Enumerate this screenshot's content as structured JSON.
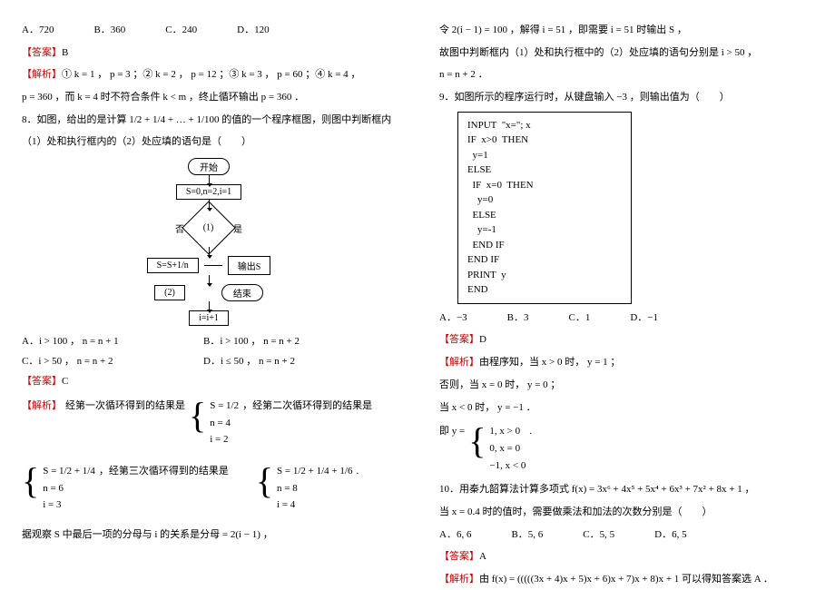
{
  "left": {
    "q7_options": [
      "A．720",
      "B．360",
      "C．240",
      "D．120"
    ],
    "q7_ans_tag": "【答案】",
    "q7_ans": "B",
    "q7_exp_tag": "【解析】",
    "q7_exp_line1": "① k = 1 ， p = 3 ；② k = 2 ， p = 12 ；③ k = 3 ， p = 60 ；④ k = 4 ，",
    "q7_exp_line2": "p = 360 ，而 k = 4 时不符合条件 k < m ，终止循环输出 p = 360 ．",
    "q8_stem_a": "8．如图，给出的是计算 1/2 + 1/4 + … + 1/100 的值的一个程序框图，则图中判断框内",
    "q8_stem_b": "（1）处和执行框内的（2）处应填的语句是（　　）",
    "flow": {
      "start": "开始",
      "init": "S=0,n=2,i=1",
      "cond": "(1)",
      "no": "否",
      "yes": "是",
      "acc": "S=S+1/n",
      "out": "输出S",
      "step": "(2)",
      "end": "结束",
      "iinc": "i=i+1"
    },
    "q8_options": [
      "A．i > 100 ， n = n + 1",
      "B．i > 100 ， n = n + 2",
      "C．i > 50 ， n = n + 2",
      "D．i ≤ 50 ， n = n + 2"
    ],
    "q8_ans_tag": "【答案】",
    "q8_ans": "C",
    "q8_exp_tag": "【解析】",
    "q8_exp_lead": "经第一次循环得到的结果是",
    "q8_exp_block1": [
      "S = 1/2",
      "n = 4",
      "i = 2"
    ],
    "q8_exp_mid": "，经第二次循环得到的结果是",
    "q8_exp_block2": [
      "S = 1/2 + 1/4",
      "n = 6",
      "i = 3"
    ],
    "q8_exp_between": "，经第三次循环得到的结果是",
    "q8_exp_block3": [
      "S = 1/2 + 1/4 + 1/6",
      "n = 8",
      "i = 4"
    ],
    "q8_exp_tail": "据观察 S 中最后一项的分母与 i 的关系是分母 = 2(i − 1) ，"
  },
  "right": {
    "cont1": "令 2(i − 1) = 100 ，解得 i = 51 ，即需要 i = 51 时输出 S ，",
    "cont2": "故图中判断框内（1）处和执行框中的（2）处应填的语句分别是 i > 50 ，",
    "cont3": "n = n + 2 ．",
    "q9_stem": "9．如图所示的程序运行时，从键盘输入 −3 ，则输出值为（　　）",
    "code": [
      "INPUT  \"x=\"; x",
      "IF  x>0  THEN",
      "  y=1",
      "ELSE",
      "  IF  x=0  THEN",
      "    y=0",
      "  ELSE",
      "    y=-1",
      "  END IF",
      "END IF",
      "PRINT  y",
      "END"
    ],
    "q9_options": [
      "A．−3",
      "B．3",
      "C．1",
      "D．−1"
    ],
    "q9_ans_tag": "【答案】",
    "q9_ans": "D",
    "q9_exp_tag": "【解析】",
    "q9_exp_l1": "由程序知，当 x > 0 时， y = 1 ；",
    "q9_exp_l2": "否则，当 x = 0 时， y = 0 ；",
    "q9_exp_l3": "当 x < 0 时， y = −1 ．",
    "q9_exp_piece_lead": "即 y =",
    "q9_exp_piece": [
      "1, x > 0",
      "0, x = 0",
      "−1, x < 0"
    ],
    "q10_stem_a": "10．用秦九韶算法计算多项式 f(x) = 3x⁶ + 4x⁵ + 5x⁴ + 6x³ + 7x² + 8x + 1 ，",
    "q10_stem_b": "当 x = 0.4 时的值时，需要做乘法和加法的次数分别是（　　）",
    "q10_options": [
      "A．6, 6",
      "B．5, 6",
      "C．5, 5",
      "D．6, 5"
    ],
    "q10_ans_tag": "【答案】",
    "q10_ans": "A",
    "q10_exp_tag": "【解析】",
    "q10_exp": "由 f(x) = (((((3x + 4)x + 5)x + 6)x + 7)x + 8)x + 1 可以得知答案选 A ．"
  }
}
